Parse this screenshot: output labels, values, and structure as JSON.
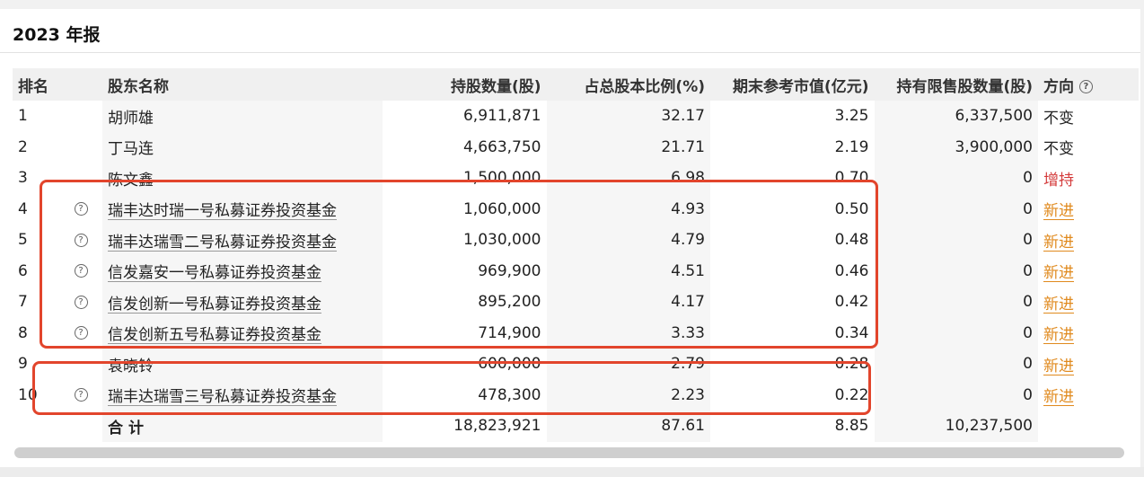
{
  "section": {
    "title": "2023 年报"
  },
  "table": {
    "headers": [
      "排名",
      "股东名称",
      "持股数量(股)",
      "占总股本比例(%)",
      "期末参考市值(亿元)",
      "持有限售股数量(股)",
      "方向"
    ],
    "rows": [
      {
        "rank": "1",
        "icon": false,
        "name": "胡师雄",
        "shares": "6,911,871",
        "ratio": "32.17",
        "value": "3.25",
        "restricted": "6,337,500",
        "dir": "不变",
        "dirType": "same"
      },
      {
        "rank": "2",
        "icon": false,
        "name": "丁马连",
        "shares": "4,663,750",
        "ratio": "21.71",
        "value": "2.19",
        "restricted": "3,900,000",
        "dir": "不变",
        "dirType": "same"
      },
      {
        "rank": "3",
        "icon": false,
        "name": "陈文鑫",
        "shares": "1,500,000",
        "ratio": "6.98",
        "value": "0.70",
        "restricted": "0",
        "dir": "增持",
        "dirType": "up"
      },
      {
        "rank": "4",
        "icon": true,
        "name": "瑞丰达时瑞一号私募证券投资基金",
        "shares": "1,060,000",
        "ratio": "4.93",
        "value": "0.50",
        "restricted": "0",
        "dir": "新进",
        "dirType": "new"
      },
      {
        "rank": "5",
        "icon": true,
        "name": "瑞丰达瑞雪二号私募证券投资基金",
        "shares": "1,030,000",
        "ratio": "4.79",
        "value": "0.48",
        "restricted": "0",
        "dir": "新进",
        "dirType": "new"
      },
      {
        "rank": "6",
        "icon": true,
        "name": "信发嘉安一号私募证券投资基金",
        "shares": "969,900",
        "ratio": "4.51",
        "value": "0.46",
        "restricted": "0",
        "dir": "新进",
        "dirType": "new"
      },
      {
        "rank": "7",
        "icon": true,
        "name": "信发创新一号私募证券投资基金",
        "shares": "895,200",
        "ratio": "4.17",
        "value": "0.42",
        "restricted": "0",
        "dir": "新进",
        "dirType": "new"
      },
      {
        "rank": "8",
        "icon": true,
        "name": "信发创新五号私募证券投资基金",
        "shares": "714,900",
        "ratio": "3.33",
        "value": "0.34",
        "restricted": "0",
        "dir": "新进",
        "dirType": "new"
      },
      {
        "rank": "9",
        "icon": false,
        "name": "袁晓铃",
        "shares": "600,000",
        "ratio": "2.79",
        "value": "0.28",
        "restricted": "0",
        "dir": "新进",
        "dirType": "new"
      },
      {
        "rank": "10",
        "icon": true,
        "name": "瑞丰达瑞雪三号私募证券投资基金",
        "shares": "478,300",
        "ratio": "2.23",
        "value": "0.22",
        "restricted": "0",
        "dir": "新进",
        "dirType": "new"
      }
    ],
    "total": {
      "label": "合计",
      "shares": "18,823,921",
      "ratio": "87.61",
      "value": "8.85",
      "restricted": "10,237,500"
    }
  },
  "icons": {
    "help": "question-circle-icon"
  },
  "colors": {
    "highlight": "#e2452c",
    "increase": "#d43a3a",
    "new": "#e08a1e"
  }
}
